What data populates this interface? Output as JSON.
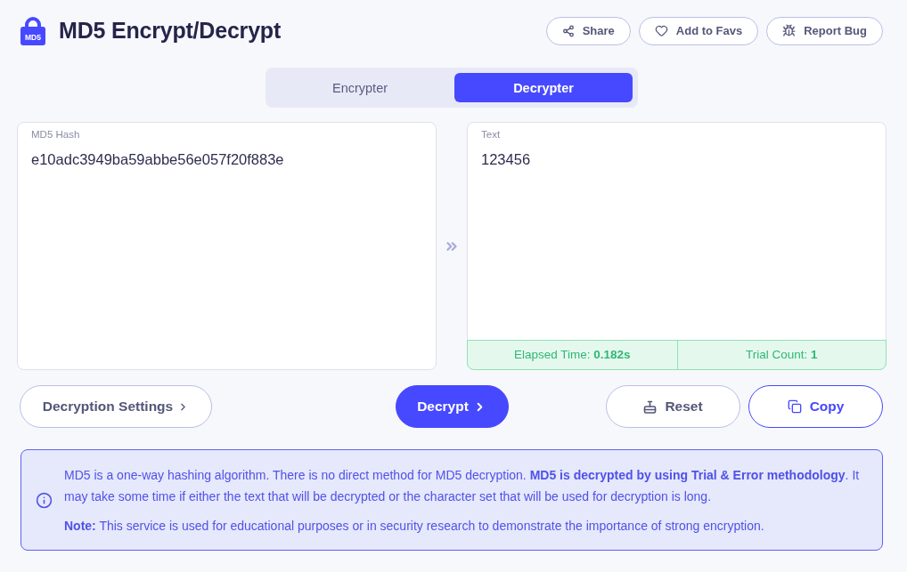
{
  "header": {
    "logo_text": "MD5",
    "title": "MD5 Encrypt/Decrypt",
    "actions": [
      {
        "kind": "share",
        "label": "Share"
      },
      {
        "kind": "favorite",
        "label": "Add to Favs"
      },
      {
        "kind": "bug",
        "label": "Report Bug"
      }
    ]
  },
  "tabs": [
    {
      "label": "Encrypter",
      "selected": false
    },
    {
      "label": "Decrypter",
      "selected": true
    }
  ],
  "input_panel": {
    "label": "MD5 Hash",
    "value": "e10adc3949ba59abbe56e057f20f883e"
  },
  "output_panel": {
    "label": "Text",
    "value": "123456",
    "stats": [
      "Elapsed Time: **0.182s**",
      "Trial Count: **1**"
    ]
  },
  "controls": [
    {
      "kind": "settings",
      "label": "Decryption Settings"
    },
    {
      "kind": "primary",
      "label": "Decrypt"
    },
    {
      "kind": "reset",
      "label": "Reset"
    },
    {
      "kind": "copy",
      "label": "Copy"
    }
  ],
  "info": {
    "paragraphs": [
      "MD5 is a one-way hashing algorithm. There is no direct method for MD5 decryption. **MD5 is decrypted by using Trial & Error methodology**. It may take some time if either the text that will be decrypted or the character set that will be used for decryption is long.",
      "**Note:** This service is used for educational purposes or in security research to demonstrate the importance of strong encryption."
    ]
  }
}
